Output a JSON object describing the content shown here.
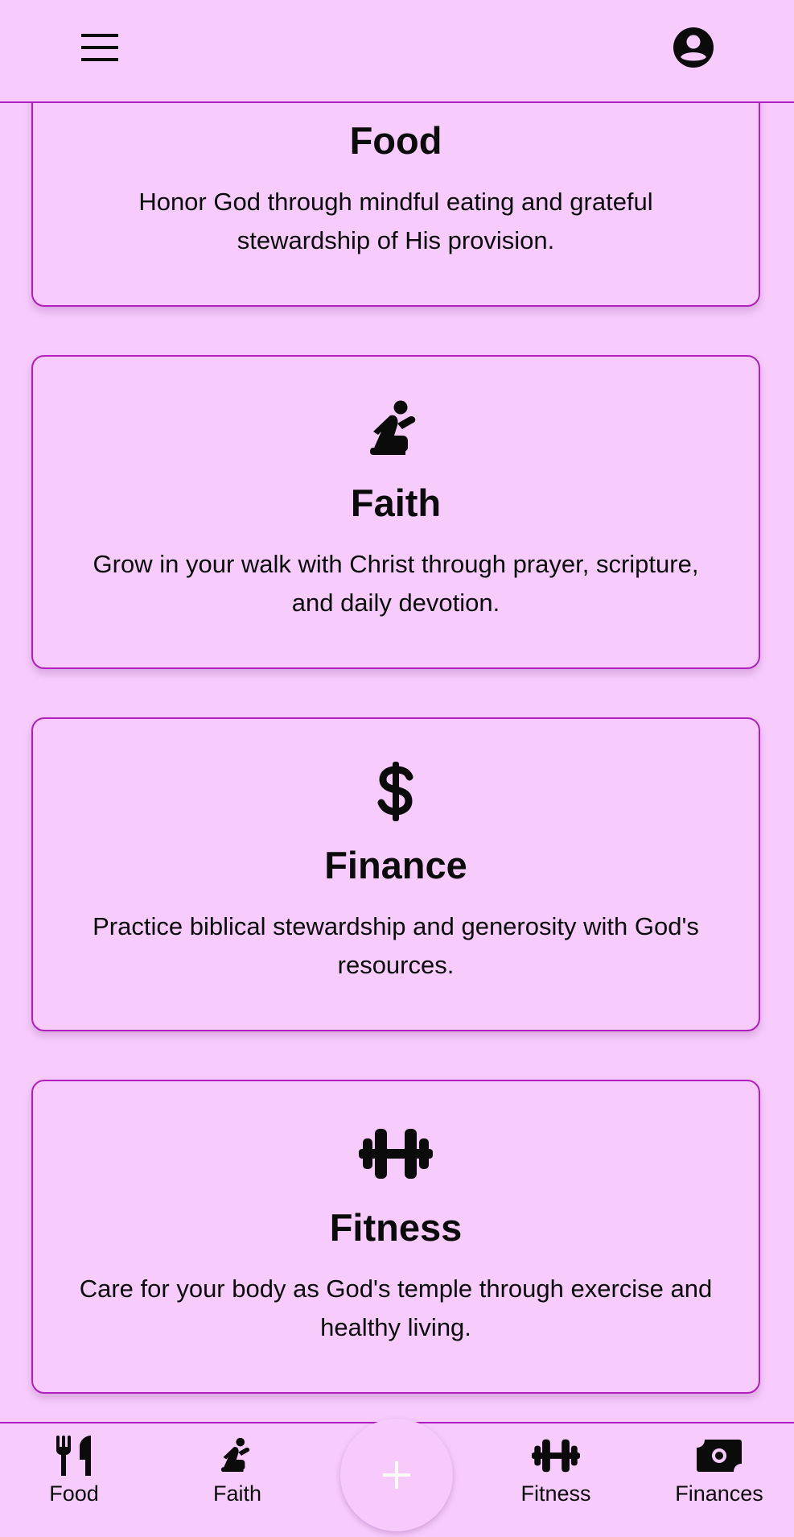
{
  "app_bar": {
    "menu_icon": "menu-icon",
    "account_icon": "account-circle-icon"
  },
  "cards": [
    {
      "icon": "food-icon",
      "title": "Food",
      "description": "Honor God through mindful eating and grateful stewardship of His provision."
    },
    {
      "icon": "praying-person-icon",
      "title": "Faith",
      "description": "Grow in your walk with Christ through prayer, scripture, and daily devotion."
    },
    {
      "icon": "dollar-sign-icon",
      "title": "Finance",
      "description": "Practice biblical stewardship and generosity with God's resources."
    },
    {
      "icon": "dumbbell-icon",
      "title": "Fitness",
      "description": "Care for your body as God's temple through exercise and healthy living."
    }
  ],
  "bottom_nav": {
    "items": [
      {
        "label": "Food",
        "icon": "utensils-icon"
      },
      {
        "label": "Faith",
        "icon": "praying-person-icon"
      },
      {
        "label": "Fitness",
        "icon": "dumbbell-icon"
      },
      {
        "label": "Finances",
        "icon": "money-bill-icon"
      }
    ],
    "fab_icon": "plus-icon"
  },
  "colors": {
    "background": "#f7ccfc",
    "border_accent": "#b11fbf",
    "text": "#0b0b0b",
    "fab_plus": "#ffffff"
  }
}
